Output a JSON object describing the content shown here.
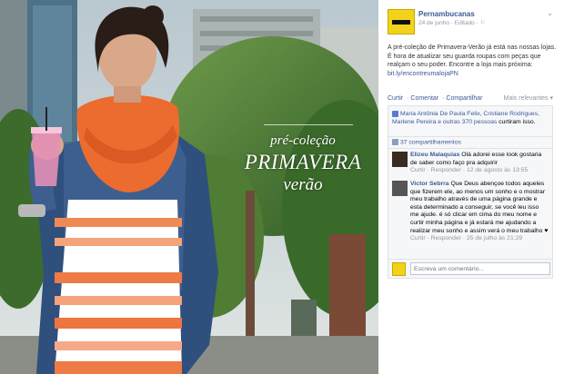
{
  "photo": {
    "caption_line1": "pré-coleção",
    "caption_line2": "PRIMAVERA",
    "caption_line3": "verão"
  },
  "post": {
    "page_name": "Pernambucanas",
    "meta": "24 de junho · Editado · ⚐",
    "text_before_link": "A pré-coleção de Primavera-Verão já está nas nossas lojas. É hora de atualizar seu guarda roupas com peças que realçam o seu poder. Encontre a loja mais próxima: ",
    "link_text": "bit.ly/encontreumalojaPN",
    "actions": [
      "Curtir",
      "Comentar",
      "Compartilhar"
    ],
    "sort_label": "Mais relevantes ▾"
  },
  "likes": {
    "names": "Maria Antônia De Paula Felix, Cristiane Rodrigues, Marlene Pereira",
    "others": "e outras 370 pessoas",
    "suffix": " curtiram isso.",
    "shares": "37 compartilhamentos"
  },
  "comments": [
    {
      "name": "Elizeu Malaquias",
      "text": "Olá adorei esse look gostaria de saber como faço pra adquirir",
      "actions": "Curtir · Responder · 12 de agosto às 13:55"
    },
    {
      "name": "Victor Sebrra",
      "text": "Que Deus abençoe todos aqueles que fizerem ele, ao menos um sonho e o mostrar meu trabalho através de uma página grande e esta determinado a conseguir, se você leu isso me ajude. é só clicar em cima do meu nome e curtir minha página e já estará me ajudando a realizar meu sonho e assim verá o meu trabalho ♥",
      "actions": "Curtir · Responder · 25 de julho às 21:29"
    }
  ],
  "write_placeholder": "Escreva um comentário..."
}
